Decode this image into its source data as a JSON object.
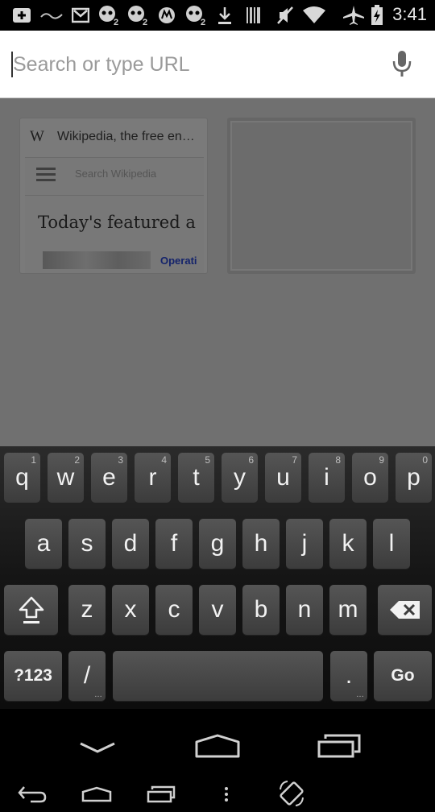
{
  "status_bar": {
    "time": "3:41",
    "icons": [
      "add-notification-icon",
      "app-notification-icon",
      "gmail-icon",
      "skull-notification-icon",
      "skull-notification-icon",
      "motorola-icon",
      "skull-notification-icon",
      "download-icon",
      "barcode-icon",
      "vibrate-mute-icon",
      "wifi-icon",
      "airplane-mode-icon",
      "battery-charging-icon"
    ]
  },
  "url_bar": {
    "placeholder": "Search or type URL",
    "value": ""
  },
  "tiles": [
    {
      "favicon": "W",
      "title": "Wikipedia, the free en…",
      "search_placeholder": "Search Wikipedia",
      "heading": "Today's featured a",
      "link": "Operati"
    }
  ],
  "keyboard": {
    "row1": [
      {
        "label": "q",
        "hint": "1"
      },
      {
        "label": "w",
        "hint": "2"
      },
      {
        "label": "e",
        "hint": "3"
      },
      {
        "label": "r",
        "hint": "4"
      },
      {
        "label": "t",
        "hint": "5"
      },
      {
        "label": "y",
        "hint": "6"
      },
      {
        "label": "u",
        "hint": "7"
      },
      {
        "label": "i",
        "hint": "8"
      },
      {
        "label": "o",
        "hint": "9"
      },
      {
        "label": "p",
        "hint": "0"
      }
    ],
    "row2": [
      "a",
      "s",
      "d",
      "f",
      "g",
      "h",
      "j",
      "k",
      "l"
    ],
    "row3": [
      "z",
      "x",
      "c",
      "v",
      "b",
      "n",
      "m"
    ],
    "symbols_label": "?123",
    "slash_label": "/",
    "period_label": ".",
    "go_label": "Go"
  }
}
